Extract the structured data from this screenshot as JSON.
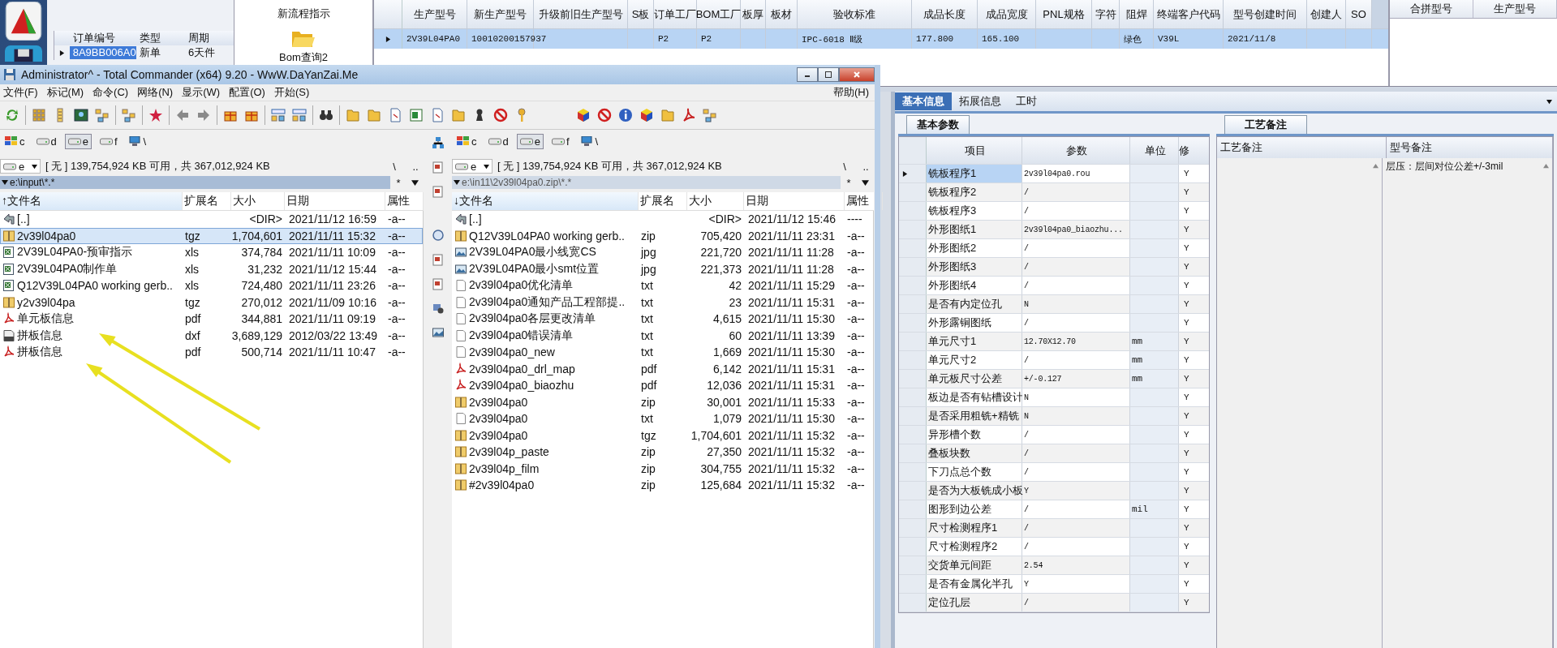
{
  "background_app": {
    "order_table": {
      "columns": [
        "订单编号",
        "类型",
        "周期"
      ],
      "rows": [
        {
          "cells": [
            "8A9BB006A0",
            "新单",
            "6天件"
          ],
          "selected": true
        }
      ]
    },
    "shortcuts": [
      {
        "label": "新流程指示",
        "kind": "text"
      },
      {
        "label": "Bom查询2",
        "kind": "folder"
      }
    ],
    "model_grid": {
      "columns": [
        {
          "header": "生产型号",
          "value": "2V39L04PA0"
        },
        {
          "header": "新生产型号",
          "value": "10010200157937"
        },
        {
          "header": "升级前旧生产型号"
        },
        {
          "header": "S板"
        },
        {
          "header": "订单工厂",
          "value": "P2"
        },
        {
          "header": "BOM工厂",
          "value": "P2"
        },
        {
          "header": "板厚"
        },
        {
          "header": "板材"
        },
        {
          "header": "验收标准",
          "value": "IPC-6018 Ⅱ级"
        },
        {
          "header": "成品长度",
          "value": "177.800"
        },
        {
          "header": "成品宽度",
          "value": "165.100"
        },
        {
          "header": "PNL规格"
        },
        {
          "header": "字符"
        },
        {
          "header": "阻焊",
          "value": "绿色"
        },
        {
          "header": "终端客户代码",
          "value": "V39L"
        },
        {
          "header": "型号创建时间",
          "value": "2021/11/8"
        },
        {
          "header": "创建人"
        },
        {
          "header": "SO"
        }
      ],
      "row_selected": true
    },
    "merge_panel": {
      "columns": [
        "合拼型号",
        "生产型号"
      ]
    },
    "tabs": [
      {
        "label": "基本信息",
        "selected": true
      },
      {
        "label": "拓展信息",
        "selected": false
      },
      {
        "label": "工时",
        "selected": false
      }
    ],
    "params_tab": "基本参数",
    "params_table": {
      "columns": [
        "项目",
        "参数",
        "单位",
        "修"
      ],
      "rows": [
        {
          "item": "铣板程序1",
          "value": "2v39l04pa0.rou",
          "edit": "Y",
          "selected": true
        },
        {
          "item": "铣板程序2",
          "value": "/",
          "edit": "Y",
          "selected": false
        },
        {
          "item": "铣板程序3",
          "value": "/",
          "edit": "Y",
          "selected": false
        },
        {
          "item": "外形图纸1",
          "value": "2v39l04pa0_biaozhu...",
          "edit": "Y",
          "selected": false
        },
        {
          "item": "外形图纸2",
          "value": "/",
          "edit": "Y",
          "selected": false
        },
        {
          "item": "外形图纸3",
          "value": "/",
          "edit": "Y",
          "selected": false
        },
        {
          "item": "外形图纸4",
          "value": "/",
          "edit": "Y",
          "selected": false
        },
        {
          "item": "是否有内定位孔",
          "value": "N",
          "edit": "Y",
          "selected": false
        },
        {
          "item": "外形露铜图纸",
          "value": "/",
          "edit": "Y",
          "selected": false
        },
        {
          "item": "单元尺寸1",
          "value": "12.70X12.70",
          "unit": "mm",
          "edit": "Y",
          "selected": false
        },
        {
          "item": "单元尺寸2",
          "value": "/",
          "unit": "mm",
          "edit": "Y",
          "selected": false
        },
        {
          "item": "单元板尺寸公差",
          "value": "+/-0.127",
          "unit": "mm",
          "edit": "Y",
          "selected": false
        },
        {
          "item": "板边是否有钻槽设计",
          "value": "N",
          "edit": "Y",
          "selected": false
        },
        {
          "item": "是否采用粗铣+精铣",
          "value": "N",
          "edit": "Y",
          "selected": false
        },
        {
          "item": "异形槽个数",
          "value": "/",
          "edit": "Y",
          "selected": false
        },
        {
          "item": "叠板块数",
          "value": "/",
          "edit": "Y",
          "selected": false
        },
        {
          "item": "下刀点总个数",
          "value": "/",
          "edit": "Y",
          "selected": false
        },
        {
          "item": "是否为大板铣成小板",
          "value": "Y",
          "edit": "Y",
          "selected": false
        },
        {
          "item": "图形到边公差",
          "value": "/",
          "unit": "mil",
          "edit": "Y",
          "selected": false
        },
        {
          "item": "尺寸检测程序1",
          "value": "/",
          "edit": "Y",
          "selected": false
        },
        {
          "item": "尺寸检测程序2",
          "value": "/",
          "edit": "Y",
          "selected": false
        },
        {
          "item": "交货单元间距",
          "value": "2.54",
          "edit": "Y",
          "selected": false
        },
        {
          "item": "是否有金属化半孔",
          "value": "Y",
          "edit": "Y",
          "selected": false
        },
        {
          "item": "定位孔层",
          "value": "/",
          "edit": "Y",
          "selected": false
        }
      ]
    },
    "notes_tab": "工艺备注",
    "notes_table": {
      "columns": [
        "工艺备注",
        "型号备注"
      ],
      "model_note": "层压：层间对位公差+/-3mil"
    }
  },
  "total_commander": {
    "title": "Administrator^ - Total Commander (x64) 9.20 - WwW.DaYanZai.Me",
    "menu": [
      "文件(F)",
      "标记(M)",
      "命令(C)",
      "网络(N)",
      "显示(W)",
      "配置(O)",
      "开始(S)"
    ],
    "help_menu": "帮助(H)",
    "panels": [
      {
        "active": true,
        "drives": [
          {
            "letter": "c",
            "selected": false
          },
          {
            "letter": "d",
            "selected": false
          },
          {
            "letter": "e",
            "selected": true
          },
          {
            "letter": "f",
            "selected": false
          },
          {
            "letter": "\\",
            "selected": false
          }
        ],
        "drive_select": "e",
        "free_space": "[ 无 ] 139,754,924 KB 可用，共 367,012,924 KB",
        "root": "\\",
        "up": "..",
        "path": "e:\\input\\*.*",
        "filter": "*",
        "columns": [
          "文件名",
          "扩展名",
          "大小",
          "日期",
          "属性"
        ],
        "sort_arrow": "↑",
        "files": [
          {
            "name": "[..]",
            "size": "<DIR>",
            "date": "2021/11/12 16:59",
            "attr": "-a--",
            "kind": "up",
            "selected": false
          },
          {
            "name": "2v39l04pa0",
            "ext": "tgz",
            "size": "1,704,601",
            "date": "2021/11/11 15:32",
            "attr": "-a--",
            "kind": "archive",
            "selected": true
          },
          {
            "name": "2V39L04PA0-预审指示",
            "ext": "xls",
            "size": "374,784",
            "date": "2021/11/11 10:09",
            "attr": "-a--",
            "kind": "sheet",
            "selected": false
          },
          {
            "name": "2V39L04PA0制作单",
            "ext": "xls",
            "size": "31,232",
            "date": "2021/11/12 15:44",
            "attr": "-a--",
            "kind": "sheet",
            "selected": false
          },
          {
            "name": "Q12V39L04PA0 working gerb..",
            "ext": "xls",
            "size": "724,480",
            "date": "2021/11/11 23:26",
            "attr": "-a--",
            "kind": "sheet",
            "selected": false
          },
          {
            "name": "y2v39l04pa",
            "ext": "tgz",
            "size": "270,012",
            "date": "2021/11/09 10:16",
            "attr": "-a--",
            "kind": "archive",
            "selected": false
          },
          {
            "name": "单元板信息",
            "ext": "pdf",
            "size": "344,881",
            "date": "2021/11/11 09:19",
            "attr": "-a--",
            "kind": "pdf",
            "selected": false
          },
          {
            "name": "拼板信息",
            "ext": "dxf",
            "size": "3,689,129",
            "date": "2012/03/22 13:49",
            "attr": "-a--",
            "kind": "dxf",
            "selected": false
          },
          {
            "name": "拼板信息",
            "ext": "pdf",
            "size": "500,714",
            "date": "2021/11/11 10:47",
            "attr": "-a--",
            "kind": "pdf",
            "selected": false
          }
        ]
      },
      {
        "active": false,
        "drives": [
          {
            "letter": "c",
            "selected": false
          },
          {
            "letter": "d",
            "selected": false
          },
          {
            "letter": "e",
            "selected": true
          },
          {
            "letter": "f",
            "selected": false
          },
          {
            "letter": "\\",
            "selected": false
          }
        ],
        "drive_select": "e",
        "free_space": "[ 无 ] 139,754,924 KB 可用，共 367,012,924 KB",
        "root": "\\",
        "up": "..",
        "path": "e:\\in11\\2v39l04pa0.zip\\*.*",
        "filter": "*",
        "columns": [
          "文件名",
          "扩展名",
          "大小",
          "日期",
          "属性"
        ],
        "sort_arrow": "↓",
        "files": [
          {
            "name": "[..]",
            "size": "<DIR>",
            "date": "2021/11/12 15:46",
            "attr": "----",
            "kind": "up",
            "selected": false
          },
          {
            "name": "Q12V39L04PA0 working gerb..",
            "ext": "zip",
            "size": "705,420",
            "date": "2021/11/11 23:31",
            "attr": "-a--",
            "kind": "archive",
            "selected": false
          },
          {
            "name": "2V39L04PA0最小线宽CS",
            "ext": "jpg",
            "size": "221,720",
            "date": "2021/11/11 11:28",
            "attr": "-a--",
            "kind": "image",
            "selected": false
          },
          {
            "name": "2V39L04PA0最小smt位置",
            "ext": "jpg",
            "size": "221,373",
            "date": "2021/11/11 11:28",
            "attr": "-a--",
            "kind": "image",
            "selected": false
          },
          {
            "name": "2v39l04pa0优化清单",
            "ext": "txt",
            "size": "42",
            "date": "2021/11/11 15:29",
            "attr": "-a--",
            "kind": "text",
            "selected": false
          },
          {
            "name": "2v39l04pa0通知产品工程部提..",
            "ext": "txt",
            "size": "23",
            "date": "2021/11/11 15:31",
            "attr": "-a--",
            "kind": "text",
            "selected": false
          },
          {
            "name": "2v39l04pa0各层更改清单",
            "ext": "txt",
            "size": "4,615",
            "date": "2021/11/11 15:30",
            "attr": "-a--",
            "kind": "text",
            "selected": false
          },
          {
            "name": "2v39l04pa0错误清单",
            "ext": "txt",
            "size": "60",
            "date": "2021/11/11 13:39",
            "attr": "-a--",
            "kind": "text",
            "selected": false
          },
          {
            "name": "2v39l04pa0_new",
            "ext": "txt",
            "size": "1,669",
            "date": "2021/11/11 15:30",
            "attr": "-a--",
            "kind": "text",
            "selected": false
          },
          {
            "name": "2v39l04pa0_drl_map",
            "ext": "pdf",
            "size": "6,142",
            "date": "2021/11/11 15:31",
            "attr": "-a--",
            "kind": "pdf",
            "selected": false
          },
          {
            "name": "2v39l04pa0_biaozhu",
            "ext": "pdf",
            "size": "12,036",
            "date": "2021/11/11 15:31",
            "attr": "-a--",
            "kind": "pdf",
            "selected": false
          },
          {
            "name": "2v39l04pa0",
            "ext": "zip",
            "size": "30,001",
            "date": "2021/11/11 15:33",
            "attr": "-a--",
            "kind": "archive",
            "selected": false
          },
          {
            "name": "2v39l04pa0",
            "ext": "txt",
            "size": "1,079",
            "date": "2021/11/11 15:30",
            "attr": "-a--",
            "kind": "text",
            "selected": false
          },
          {
            "name": "2v39l04pa0",
            "ext": "tgz",
            "size": "1,704,601",
            "date": "2021/11/11 15:32",
            "attr": "-a--",
            "kind": "archive",
            "selected": false
          },
          {
            "name": "2v39l04p_paste",
            "ext": "zip",
            "size": "27,350",
            "date": "2021/11/11 15:32",
            "attr": "-a--",
            "kind": "archive",
            "selected": false
          },
          {
            "name": "2v39l04p_film",
            "ext": "zip",
            "size": "304,755",
            "date": "2021/11/11 15:32",
            "attr": "-a--",
            "kind": "archive",
            "selected": false
          },
          {
            "name": "#2v39l04pa0",
            "ext": "zip",
            "size": "125,684",
            "date": "2021/11/11 15:32",
            "attr": "-a--",
            "kind": "archive",
            "selected": false
          }
        ]
      }
    ]
  }
}
